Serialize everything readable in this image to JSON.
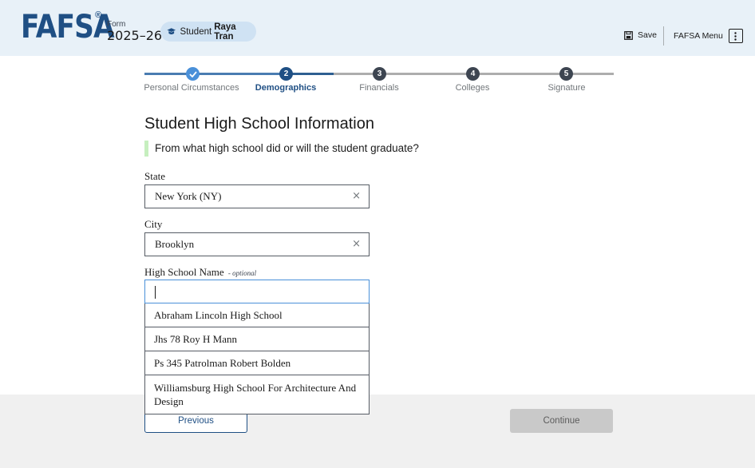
{
  "header": {
    "logo": "FAFSA",
    "logo_mark": "®",
    "form_label": "Form",
    "form_year": "2025–26",
    "student_prefix": "Student",
    "student_name": "Raya Tran",
    "save_label": "Save",
    "menu_label": "FAFSA Menu"
  },
  "stepper": {
    "steps": [
      {
        "label": "Personal Circumstances",
        "number": "",
        "status": "done"
      },
      {
        "label": "Demographics",
        "number": "2",
        "status": "current"
      },
      {
        "label": "Financials",
        "number": "3",
        "status": "upcoming"
      },
      {
        "label": "Colleges",
        "number": "4",
        "status": "upcoming"
      },
      {
        "label": "Signature",
        "number": "5",
        "status": "upcoming"
      }
    ]
  },
  "main": {
    "title": "Student High School Information",
    "question": "From what high school did or will the student graduate?",
    "state": {
      "label": "State",
      "value": "New York (NY)"
    },
    "city": {
      "label": "City",
      "value": "Brooklyn"
    },
    "high_school": {
      "label": "High School Name",
      "optional": "- optional",
      "value": ""
    },
    "suggestions": [
      "Abraham Lincoln High School",
      "Jhs 78 Roy H Mann",
      "Ps 345 Patrolman Robert Bolden",
      "Williamsburg High School For Architecture And Design"
    ]
  },
  "footer": {
    "previous_label": "Previous",
    "continue_label": "Continue"
  },
  "colors": {
    "brand": "#1f4f84",
    "header_bg": "#e8f1f8",
    "step_done": "#4a90d9",
    "question_accent": "#c6efbf",
    "continue_disabled": "#c9c9c9"
  },
  "icons": {
    "student": "student-icon",
    "save": "save-icon",
    "menu": "kebab-menu-icon",
    "clear": "clear-x-icon",
    "check": "check-icon"
  }
}
